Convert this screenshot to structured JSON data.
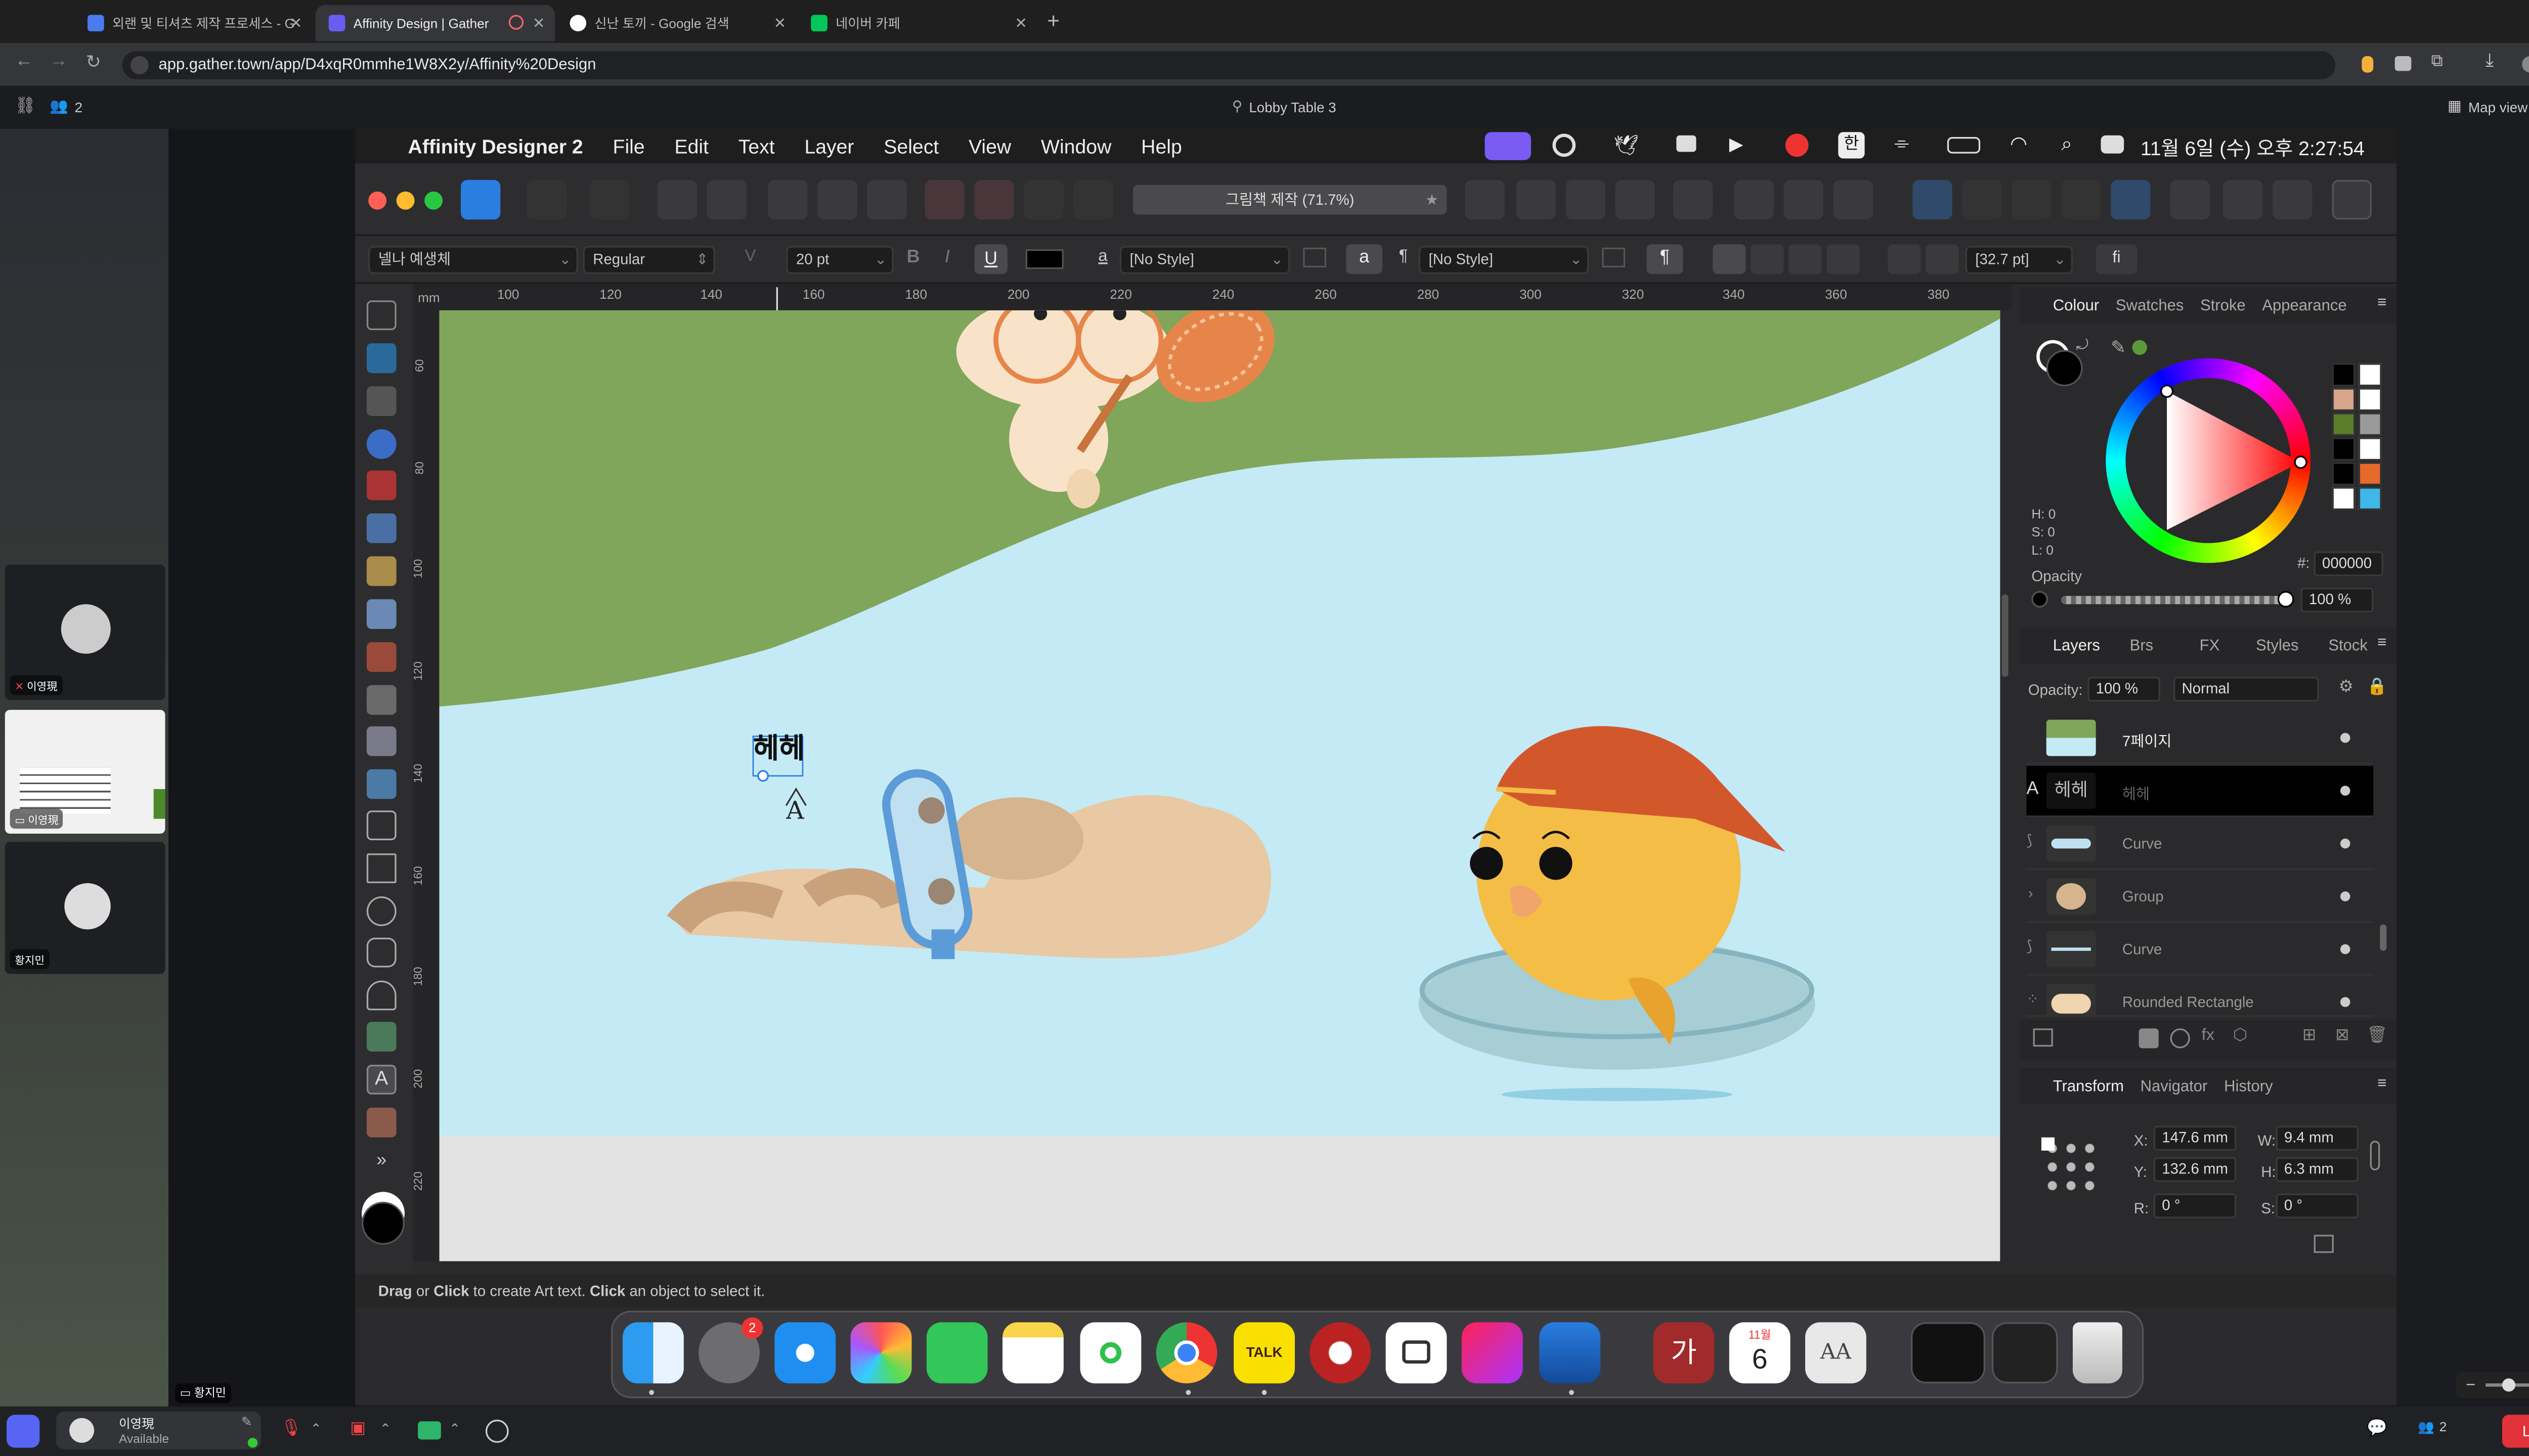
{
  "browser": {
    "tabs": [
      {
        "title": "외랜 및 티셔츠 제작 프로세스 - Go",
        "active": false,
        "color": "#4a7cf0"
      },
      {
        "title": "Affinity Design | Gather",
        "active": true,
        "color": "#6a5cf3"
      },
      {
        "title": "신난 토끼 - Google 검색",
        "active": false,
        "color": "#ffffff"
      },
      {
        "title": "네이버 카페",
        "active": false,
        "color": "#03c75a"
      }
    ],
    "new_tab": "+",
    "url": "app.gather.town/app/D4xqR0mmhe1W8X2y/Affinity%20Design"
  },
  "gather": {
    "participants": "2",
    "location": "Lobby Table 3",
    "map_view": "Map view",
    "videos": [
      {
        "label": "이영現"
      },
      {
        "label": "이영現"
      },
      {
        "label": "황지민"
      }
    ],
    "bottom_label": "황지민",
    "me": {
      "name": "이영現",
      "status": "Available"
    },
    "count": "2",
    "leave": "Leave"
  },
  "mac": {
    "menus": [
      "Affinity Designer 2",
      "File",
      "Edit",
      "Text",
      "Layer",
      "Select",
      "View",
      "Window",
      "Help"
    ],
    "clock": "11월 6일 (수) 오후 2:27:54",
    "ime": "한"
  },
  "affinity": {
    "doc_title": "그림책 제작 (71.7%)",
    "font_family": "넬나 예생체",
    "font_style": "Regular",
    "font_size": "20 pt",
    "char_style": "[No Style]",
    "para_style": "[No Style]",
    "leading": "[32.7 pt]",
    "ligature": "fi",
    "bold": "B",
    "italic": "I",
    "underline": "U",
    "a_glyph": "a",
    "pilcrow": "¶",
    "ruler_unit": "mm",
    "h_ruler": [
      "100",
      "120",
      "140",
      "160",
      "180",
      "200",
      "220",
      "240",
      "260",
      "280",
      "300",
      "320",
      "340",
      "360",
      "380"
    ],
    "v_ruler": [
      "60",
      "80",
      "100",
      "120",
      "140",
      "160",
      "180",
      "200",
      "220"
    ],
    "canvas_text": "헤헤",
    "status_parts": [
      "Drag",
      " or ",
      "Click",
      " to create Art text. ",
      "Click",
      " an object to select it."
    ],
    "colour": {
      "tabs": [
        "Colour",
        "Swatches",
        "Stroke",
        "Appearance"
      ],
      "h": "H: 0",
      "s": "S: 0",
      "l": "L: 0",
      "hex_label": "#:",
      "hex": "000000",
      "opacity_label": "Opacity",
      "opacity": "100 %",
      "swatches": [
        "#000000",
        "#ffffff",
        "#d9a58a",
        "#ffffff",
        "#5a7d2b",
        "#9a9a9a",
        "#000000",
        "#ffffff",
        "#000000",
        "#e86a2b",
        "#ffffff",
        "#3fb7e8"
      ]
    },
    "layers": {
      "tabs": [
        "Layers",
        "Brs",
        "FX",
        "Styles",
        "Stock"
      ],
      "opacity_label": "Opacity:",
      "opacity": "100 %",
      "blend": "Normal",
      "items": [
        {
          "name": "7페이지",
          "selected": false
        },
        {
          "name": "헤헤",
          "selected": true
        },
        {
          "name": "Curve",
          "selected": false
        },
        {
          "name": "Group",
          "selected": false
        },
        {
          "name": "Curve",
          "selected": false
        },
        {
          "name": "Rounded Rectangle",
          "selected": false
        }
      ]
    },
    "transform": {
      "tabs": [
        "Transform",
        "Navigator",
        "History"
      ],
      "x_label": "X:",
      "x": "147.6 mm",
      "y_label": "Y:",
      "y": "132.6 mm",
      "w_label": "W:",
      "w": "9.4 mm",
      "h_label": "H:",
      "h": "6.3 mm",
      "r_label": "R:",
      "r": "0 °",
      "s_label": "S:",
      "s": "0 °"
    }
  },
  "dock": {
    "badge": "2",
    "talk": "TALK",
    "ga": "가",
    "cal_month": "11월",
    "cal_day": "6",
    "font_book": "AA"
  }
}
